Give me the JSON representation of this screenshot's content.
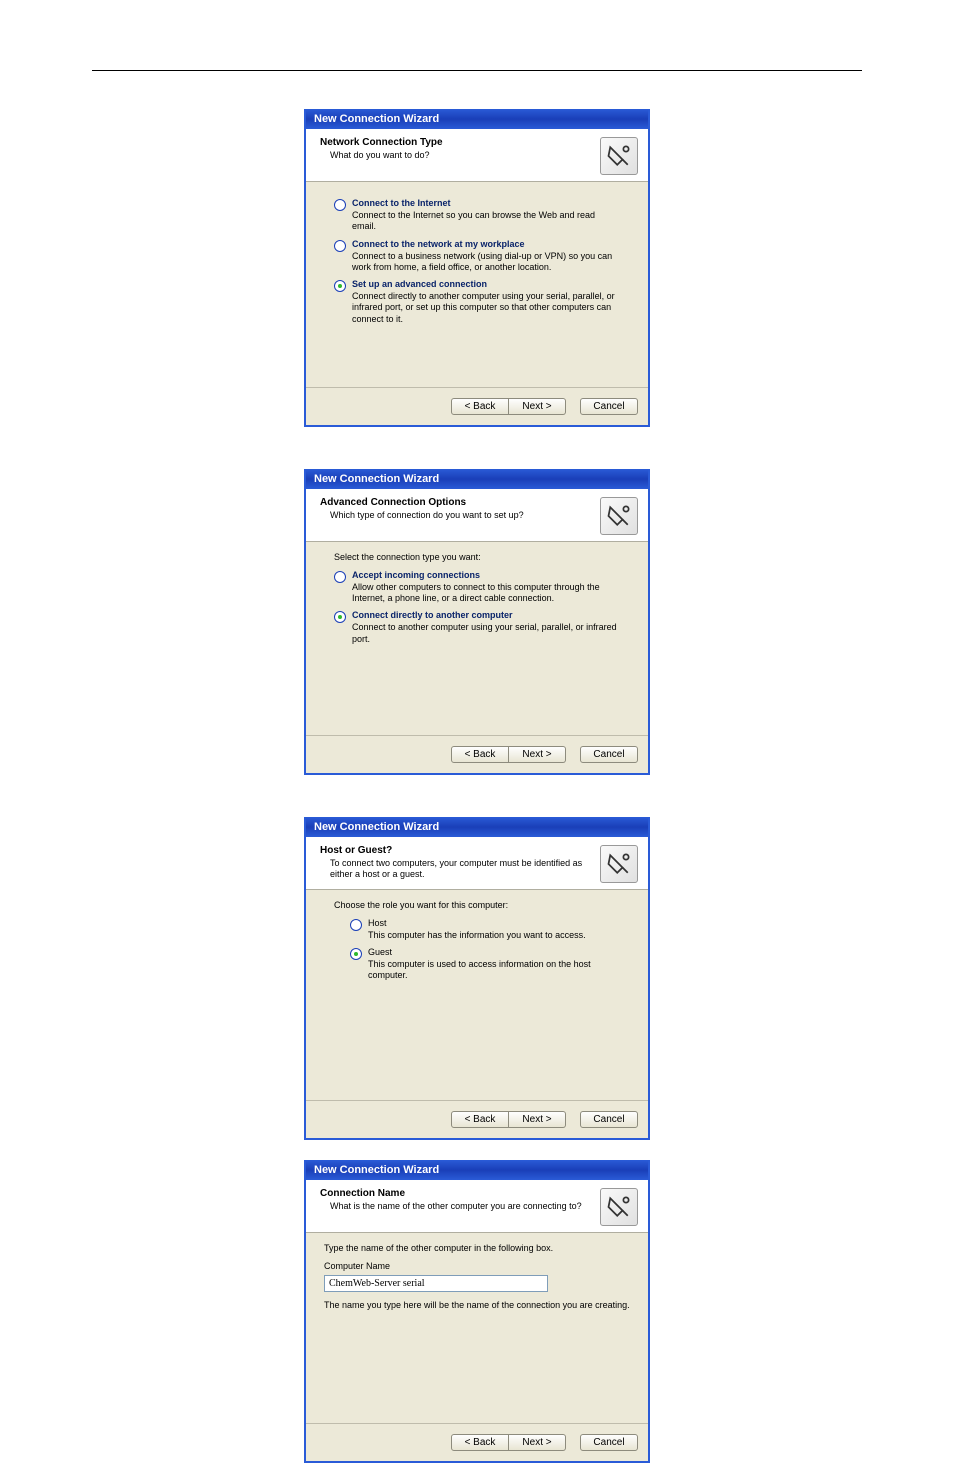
{
  "wiz_title": "New Connection Wizard",
  "buttons": {
    "back": "< Back",
    "next": "Next >",
    "cancel": "Cancel"
  },
  "w1": {
    "title": "Network Connection Type",
    "sub": "What do you want to do?",
    "opts": [
      {
        "label": "Connect to the Internet",
        "desc": "Connect to the Internet so you can browse the Web and read email.",
        "sel": false
      },
      {
        "label": "Connect to the network at my workplace",
        "desc": "Connect to a business network (using dial-up or VPN) so you can work from home, a field office, or another location.",
        "sel": false
      },
      {
        "label": "Set up an advanced connection",
        "desc": "Connect directly to another computer using your serial, parallel, or infrared port, or set up this computer so that other computers can connect to it.",
        "sel": true
      }
    ]
  },
  "w2": {
    "title": "Advanced Connection Options",
    "sub": "Which type of connection do you want to set up?",
    "intro": "Select the connection type you want:",
    "opts": [
      {
        "label": "Accept incoming connections",
        "desc": "Allow other computers to connect to this computer through the Internet, a phone line, or a direct cable connection.",
        "sel": false
      },
      {
        "label": "Connect directly to another computer",
        "desc": "Connect to another computer using your serial, parallel, or infrared port.",
        "sel": true
      }
    ]
  },
  "w3": {
    "title": "Host or Guest?",
    "sub": "To connect two computers, your computer must be identified as either a host or a guest.",
    "intro": "Choose the role you want for this computer:",
    "opts": [
      {
        "label": "Host",
        "desc": "This computer has the information you want to access.",
        "sel": false
      },
      {
        "label": "Guest",
        "desc": "This computer is used to access information on the host computer.",
        "sel": true
      }
    ]
  },
  "w4": {
    "title": "Connection Name",
    "sub": "What is the name of the other computer you are connecting to?",
    "intro": "Type the name of the other computer in the following box.",
    "label": "Computer Name",
    "value": "ChemWeb-Server serial",
    "helper": "The name you type here will be the name of the connection you are creating."
  }
}
